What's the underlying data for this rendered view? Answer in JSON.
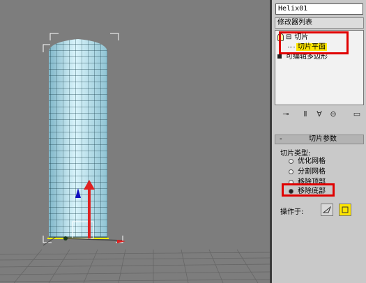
{
  "panel": {
    "object_name": "Helix01",
    "modifier_list_label": "修改器列表",
    "stack": {
      "slice_label": "切片",
      "slice_expand": "⊟",
      "slice_plane_label": "切片平面",
      "edit_poly_label": "可编辑多边形"
    },
    "toolbar_icons": [
      "pin-stack-icon",
      "show-end-result-icon",
      "make-unique-icon",
      "remove-modifier-icon",
      "configure-modifier-sets-icon"
    ],
    "rollout": {
      "collapse": "-",
      "title": "切片参数",
      "slice_type_label": "切片类型:",
      "options": [
        {
          "label": "优化网格",
          "selected": false
        },
        {
          "label": "分割网格",
          "selected": false
        },
        {
          "label": "移除顶部",
          "selected": false
        },
        {
          "label": "移除底部",
          "selected": true
        }
      ],
      "operate_on_label": "操作于:"
    },
    "colors": {
      "highlight": "#e00000",
      "selected_stack_row": "#ffe600",
      "panel_bg": "#c9c9c9",
      "viewport_bg": "#7d7d7d"
    }
  }
}
